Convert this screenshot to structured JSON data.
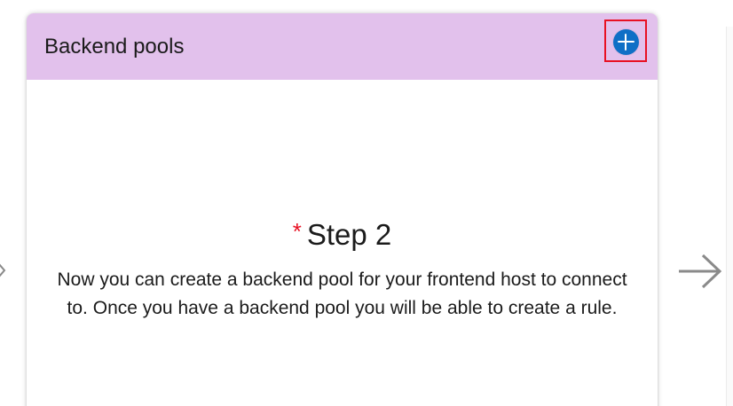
{
  "card": {
    "title": "Backend pools",
    "add_button_icon": "plus-circle-icon",
    "header_color": "#e2c1ec",
    "add_button_color": "#0f6fc6",
    "highlight_color": "#e81123"
  },
  "step": {
    "required_marker": "*",
    "heading": "Step 2",
    "description": "Now you can create a backend pool for your frontend host to connect to. Once you have a backend pool you will be able to create a rule."
  },
  "navigation": {
    "left_icon": "chevron-right-icon",
    "right_icon": "arrow-right-icon"
  }
}
